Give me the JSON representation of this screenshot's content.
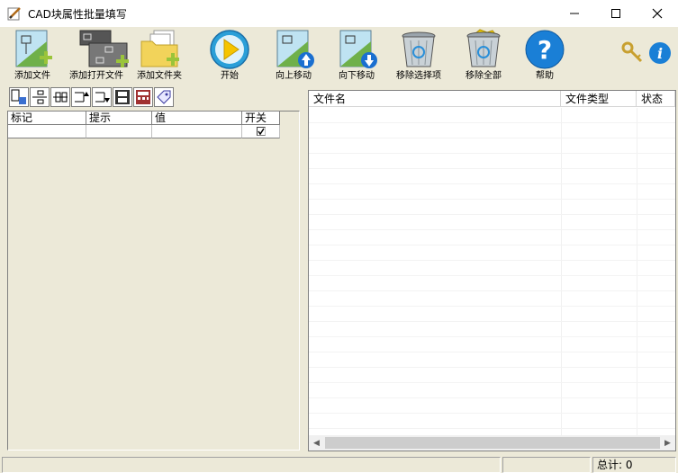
{
  "window": {
    "title": "CAD块属性批量填写",
    "icon": "pencil-doc-icon"
  },
  "toolbar": [
    {
      "label": "添加文件",
      "icon": "add-file-icon"
    },
    {
      "label": "添加打开文件",
      "icon": "add-open-file-icon"
    },
    {
      "label": "添加文件夹",
      "icon": "add-folder-icon"
    },
    {
      "label": "开始",
      "icon": "play-icon"
    },
    {
      "label": "向上移动",
      "icon": "move-up-icon"
    },
    {
      "label": "向下移动",
      "icon": "move-down-icon"
    },
    {
      "label": "移除选择项",
      "icon": "recycle-bin-icon"
    },
    {
      "label": "移除全部",
      "icon": "recycle-bin-full-icon"
    },
    {
      "label": "帮助",
      "icon": "help-icon"
    }
  ],
  "extra_icons": [
    "keys-icon",
    "info-icon"
  ],
  "attr_table": {
    "columns": [
      "标记",
      "提示",
      "值",
      "开关"
    ],
    "rows": [
      {
        "tag": "",
        "prompt": "",
        "value": "",
        "switch": true
      }
    ]
  },
  "file_list": {
    "columns": [
      "文件名",
      "文件类型",
      "状态"
    ],
    "rows": []
  },
  "status": {
    "total_label": "总计: 0"
  },
  "colors": {
    "face": "#ece9d8",
    "help_blue": "#1a7fd6",
    "play_yellow": "#f5c400"
  }
}
